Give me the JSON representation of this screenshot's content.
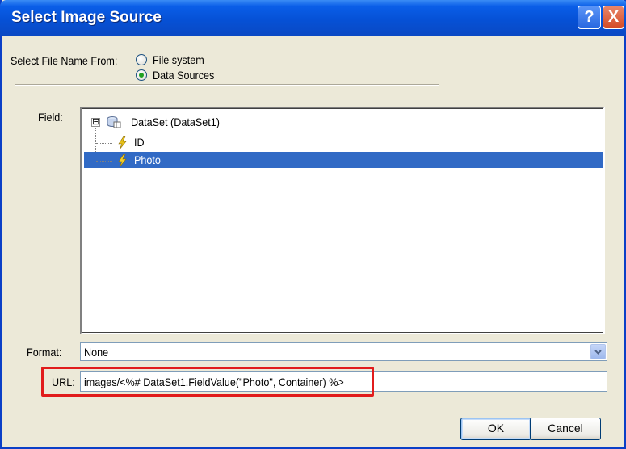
{
  "window": {
    "title": "Select Image Source",
    "help_label": "?",
    "close_label": "X"
  },
  "source": {
    "label": "Select File Name From:",
    "options": [
      {
        "label": "File system",
        "selected": false
      },
      {
        "label": "Data Sources",
        "selected": true
      }
    ]
  },
  "field": {
    "label": "Field:",
    "expander": "⊟",
    "root": "DataSet (DataSet1)",
    "children": [
      {
        "label": "ID",
        "selected": false
      },
      {
        "label": "Photo",
        "selected": true
      }
    ]
  },
  "format": {
    "label": "Format:",
    "value": "None",
    "arrow": "⌄"
  },
  "url": {
    "label": "URL:",
    "value": "images/<%# DataSet1.FieldValue(\"Photo\", Container) %>"
  },
  "buttons": {
    "ok": "OK",
    "cancel": "Cancel"
  },
  "colors": {
    "title_bar": "#0651d6",
    "selection": "#316ac5",
    "highlight": "#e11c1c",
    "radio_dot": "#21a121"
  }
}
